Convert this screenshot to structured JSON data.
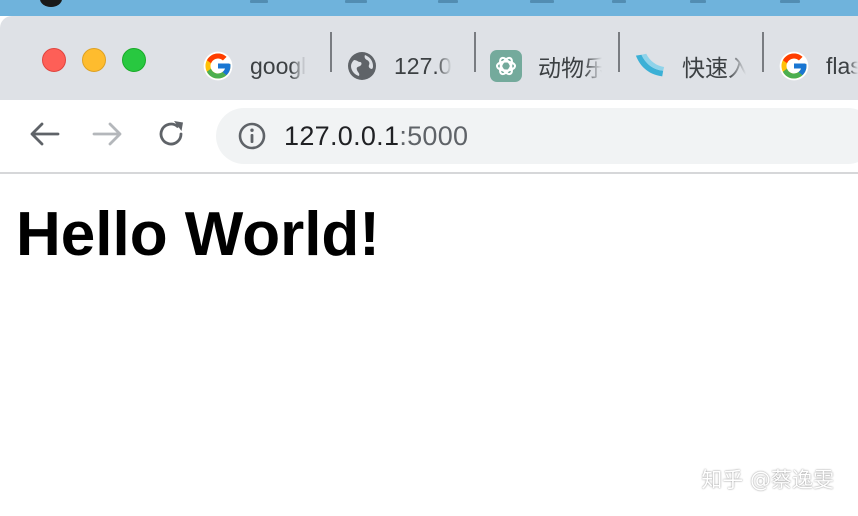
{
  "tabs": [
    {
      "label": "googl",
      "icon": "google-g-icon"
    },
    {
      "label": "127.0",
      "icon": "globe-icon"
    },
    {
      "label": "动物乐",
      "icon": "chatgpt-icon"
    },
    {
      "label": "快速入",
      "icon": "flask-icon"
    },
    {
      "label": "flas",
      "icon": "google-g-icon"
    }
  ],
  "toolbar": {
    "back_icon": "back-arrow-icon",
    "forward_icon": "forward-arrow-icon",
    "reload_icon": "reload-icon",
    "info_icon": "info-icon",
    "url_host": "127.0.0.1",
    "url_port": ":5000"
  },
  "page": {
    "heading": "Hello World!"
  },
  "watermark": {
    "text": "知乎 @蔡逸雯"
  },
  "colors": {
    "tabstrip_bg": "#dee1e6",
    "omnibox_bg": "#f1f3f4",
    "close": "#fe5f57",
    "minimize": "#febc2e",
    "zoom": "#28c840",
    "menubar_bg": "#6fb3dc"
  }
}
